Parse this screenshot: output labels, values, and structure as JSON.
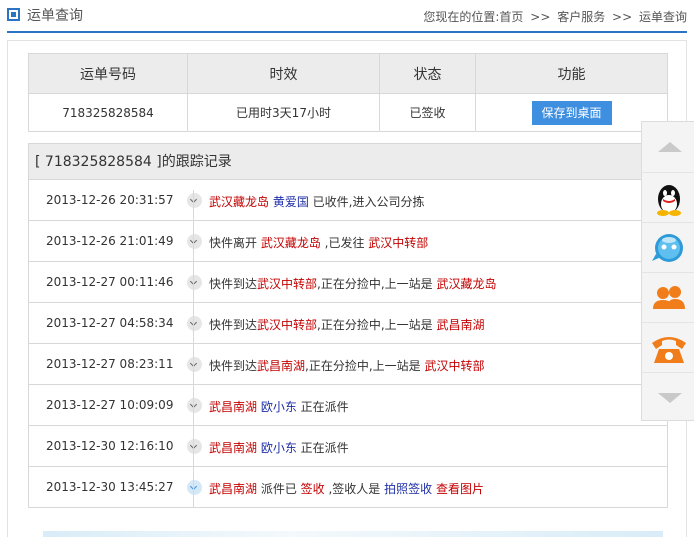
{
  "header": {
    "title": "运单查询",
    "breadcrumb": {
      "prefix": "您现在的位置:",
      "items": [
        "首页",
        "客户服务",
        "运单查询"
      ],
      "separator": ">>"
    }
  },
  "summary": {
    "headers": [
      "运单号码",
      "时效",
      "状态",
      "功能"
    ],
    "waybill_no": "718325828584",
    "duration": "已用时3天17小时",
    "status": "已签收",
    "save_button": "保存到桌面"
  },
  "tracking": {
    "title_open": "[ ",
    "waybill_no": "718325828584",
    "title_close": " ]的跟踪记录",
    "records": [
      {
        "time": "2013-12-26 20:31:57",
        "parts": [
          {
            "t": "武汉藏龙岛",
            "c": "r"
          },
          {
            "t": " ",
            "c": ""
          },
          {
            "t": "黄爱国",
            "c": "b"
          },
          {
            "t": " 已收件,进入公司分拣",
            "c": ""
          }
        ]
      },
      {
        "time": "2013-12-26 21:01:49",
        "parts": [
          {
            "t": "快件离开 ",
            "c": ""
          },
          {
            "t": "武汉藏龙岛",
            "c": "r"
          },
          {
            "t": " ,已发往 ",
            "c": ""
          },
          {
            "t": "武汉中转部",
            "c": "r"
          }
        ]
      },
      {
        "time": "2013-12-27 00:11:46",
        "parts": [
          {
            "t": "快件到达",
            "c": ""
          },
          {
            "t": "武汉中转部",
            "c": "r"
          },
          {
            "t": ",正在分捡中,上一站是 ",
            "c": ""
          },
          {
            "t": "武汉藏龙岛",
            "c": "r"
          }
        ]
      },
      {
        "time": "2013-12-27 04:58:34",
        "parts": [
          {
            "t": "快件到达",
            "c": ""
          },
          {
            "t": "武汉中转部",
            "c": "r"
          },
          {
            "t": ",正在分捡中,上一站是 ",
            "c": ""
          },
          {
            "t": "武昌南湖",
            "c": "r"
          }
        ]
      },
      {
        "time": "2013-12-27 08:23:11",
        "parts": [
          {
            "t": "快件到达",
            "c": ""
          },
          {
            "t": "武昌南湖",
            "c": "r"
          },
          {
            "t": ",正在分捡中,上一站是 ",
            "c": ""
          },
          {
            "t": "武汉中转部",
            "c": "r"
          }
        ]
      },
      {
        "time": "2013-12-27 10:09:09",
        "parts": [
          {
            "t": "武昌南湖",
            "c": "r"
          },
          {
            "t": " ",
            "c": ""
          },
          {
            "t": "欧小东",
            "c": "b"
          },
          {
            "t": " 正在派件",
            "c": ""
          }
        ]
      },
      {
        "time": "2013-12-30 12:16:10",
        "parts": [
          {
            "t": "武昌南湖",
            "c": "r"
          },
          {
            "t": " ",
            "c": ""
          },
          {
            "t": "欧小东",
            "c": "b"
          },
          {
            "t": " 正在派件",
            "c": ""
          }
        ]
      },
      {
        "time": "2013-12-30 13:45:27",
        "parts": [
          {
            "t": "武昌南湖",
            "c": "r"
          },
          {
            "t": " 派件已 ",
            "c": ""
          },
          {
            "t": "签收",
            "c": "r"
          },
          {
            "t": " ,签收人是 ",
            "c": ""
          },
          {
            "t": "拍照签收",
            "c": "b"
          },
          {
            "t": " ",
            "c": ""
          },
          {
            "t": "查看图片",
            "c": "r"
          }
        ]
      }
    ]
  },
  "sidebar": {
    "icons": [
      "scroll-up-icon",
      "qq-icon",
      "chat-bubble-icon",
      "contacts-icon",
      "telephone-icon",
      "scroll-down-icon"
    ]
  },
  "colors": {
    "accent": "#2b73c4",
    "button": "#3f8fe0",
    "place_red": "#c40000",
    "person_blue": "#1f2fa8"
  }
}
